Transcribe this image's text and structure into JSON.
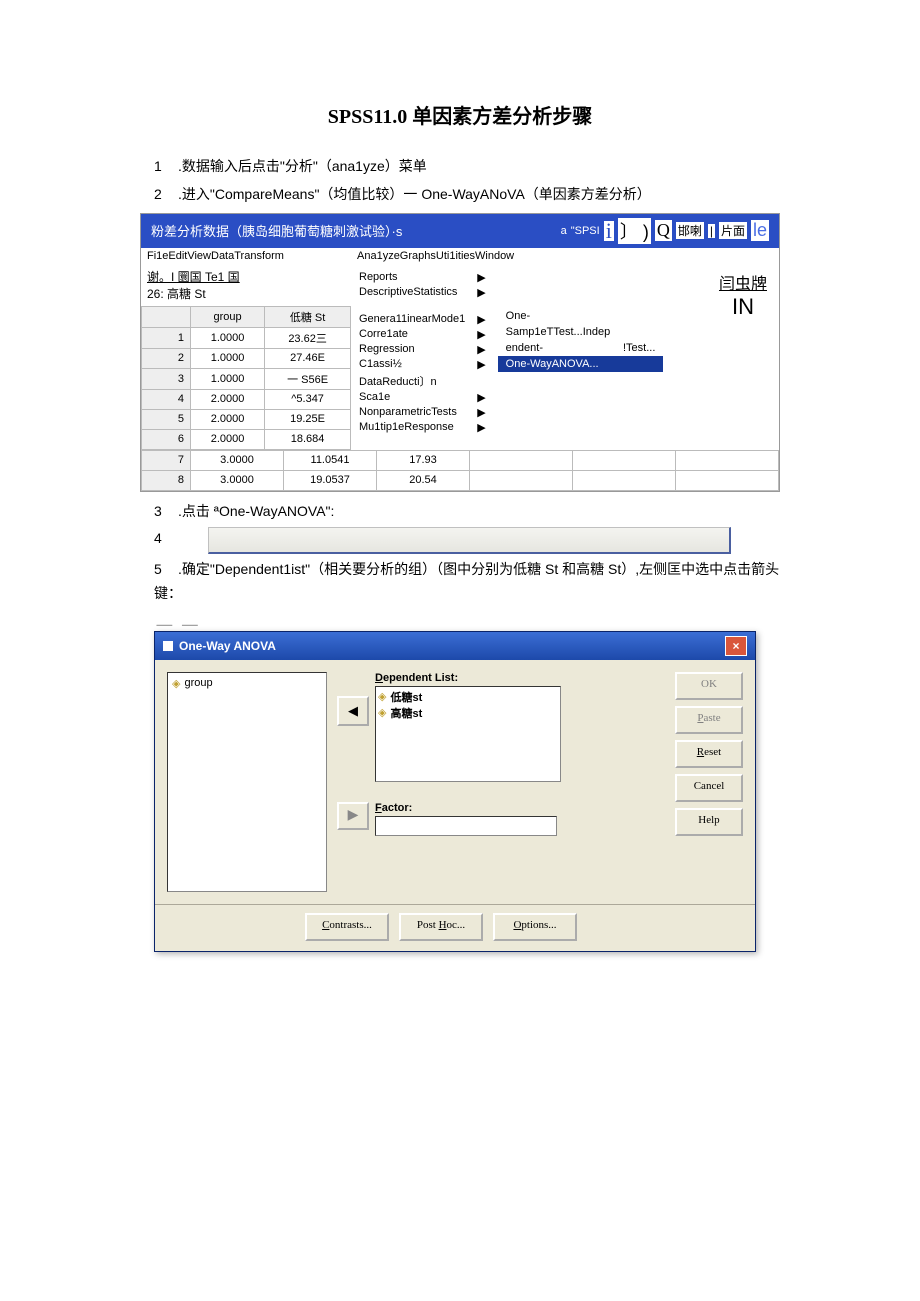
{
  "title": "SPSS11.0 单因素方差分析步骤",
  "steps": {
    "s1": ".数据输入后点击\"分析\"（ana1yze）菜单",
    "s2": ".进入\"CompareMeans\"（均值比较）一 One-WayANoVA（单因素方差分析）",
    "s3": ".点击 ªOne-WayANOVA\":",
    "s4": "",
    "s5": ".确定\"Dependent1ist\"（相关要分析的组）（图中分别为低糖 St 和高糖 St）,左侧匡中选中点击箭头键："
  },
  "spss": {
    "titlebar": {
      "left": "粉差分析数据（胰岛细胞葡萄糖刺激试验）·s",
      "a": "a",
      "spsi": "\"SPSI",
      "i": "i",
      "brac": "〕   )",
      "q": "Q",
      "txt1": "邯喇",
      "pipe": "|",
      "txt2": "片面",
      "le": "le"
    },
    "menubar": {
      "left": "Fi1eEditViewDataTransform",
      "right": "Ana1yzeGraphsUti1itiesWindow"
    },
    "cellinfo": {
      "line1": "谢。I 圜国 Te1 国",
      "line2": "26: 高糖 St"
    },
    "columns": {
      "c1": "group",
      "c2": "低糖 St"
    },
    "rows": [
      {
        "n": "1",
        "g": "1.0000",
        "v": "23.62三"
      },
      {
        "n": "2",
        "g": "1.0000",
        "v": "27.46E"
      },
      {
        "n": "3",
        "g": "1.0000",
        "v": "一 S56E"
      },
      {
        "n": "4",
        "g": "2.0000",
        "v": "^5.347"
      },
      {
        "n": "5",
        "g": "2.0000",
        "v": "19.25E"
      },
      {
        "n": "6",
        "g": "2.0000",
        "v": "18.684"
      },
      {
        "n": "7",
        "g": "3.0000",
        "v": "11.0541",
        "extra": "17.93"
      },
      {
        "n": "8",
        "g": "3.0000",
        "v": "19.0537",
        "extra": "20.54"
      }
    ],
    "analyze_menu": [
      "Reports",
      "DescriptiveStatistics",
      "",
      "Genera11inearMode1",
      "Corre1ate",
      "Regression",
      "C1assi½",
      "DataReducti〕n",
      "Sca1e",
      "NonparametricTests",
      "Mu1tip1eResponse"
    ],
    "compare_sub": {
      "one": "One-",
      "samp": "Samp1eTTest...Indep",
      "end": "endent-",
      "test": "!Test...",
      "hl": "One-WayANOVA..."
    },
    "deco": {
      "u": "闫虫牌",
      "in": "IN"
    }
  },
  "dialog": {
    "pre": "⸺    ⸺",
    "title": "One-Way ANOVA",
    "source_var": "group",
    "dep_label": "Dependent List:",
    "dep1": "低糖st",
    "dep2": "高糖st",
    "factor_label": "Factor:",
    "buttons": {
      "ok": "OK",
      "paste": "Paste",
      "reset": "Reset",
      "cancel": "Cancel",
      "help": "Help"
    },
    "bottom": {
      "contrasts": "Contrasts...",
      "posthoc": "Post Hoc...",
      "options": "Options..."
    }
  }
}
